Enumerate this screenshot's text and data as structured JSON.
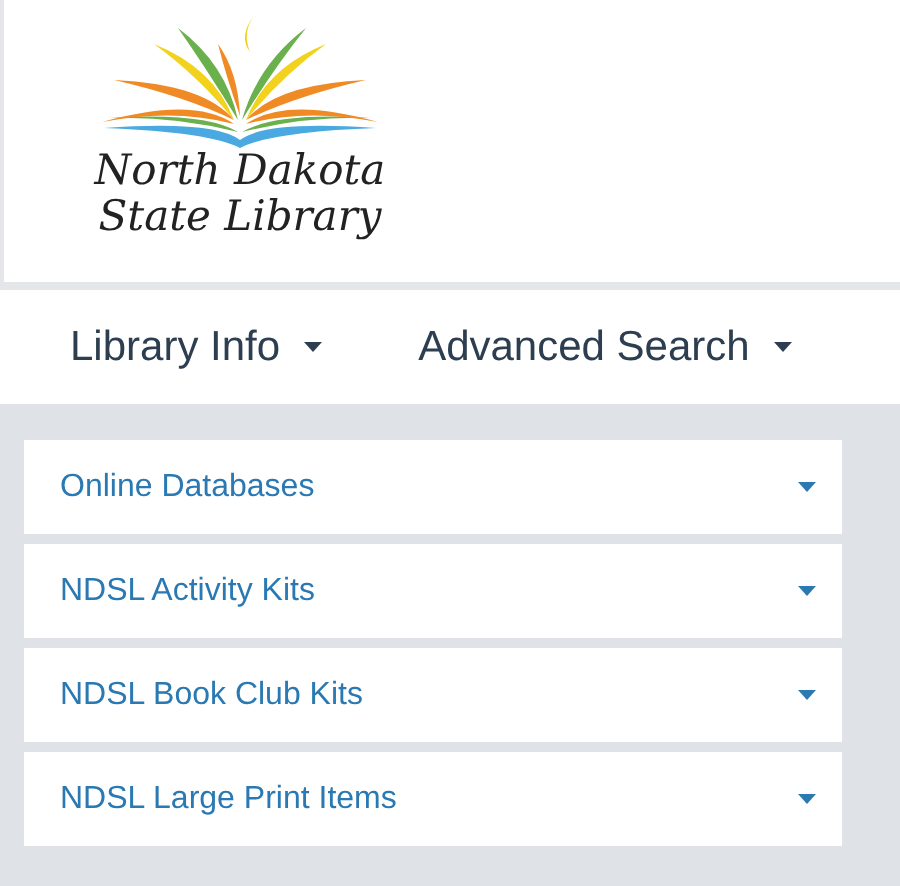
{
  "logo": {
    "lines": [
      "North Dakota",
      "State Library"
    ]
  },
  "nav": [
    {
      "label": "Library Info",
      "expanded": false
    },
    {
      "label": "Advanced Search",
      "expanded": false
    }
  ],
  "panels": [
    {
      "label": "Online Databases",
      "expanded": false
    },
    {
      "label": "NDSL Activity Kits",
      "expanded": false
    },
    {
      "label": "NDSL Book Club Kits",
      "expanded": false
    },
    {
      "label": "NDSL Large Print Items",
      "expanded": false
    }
  ]
}
